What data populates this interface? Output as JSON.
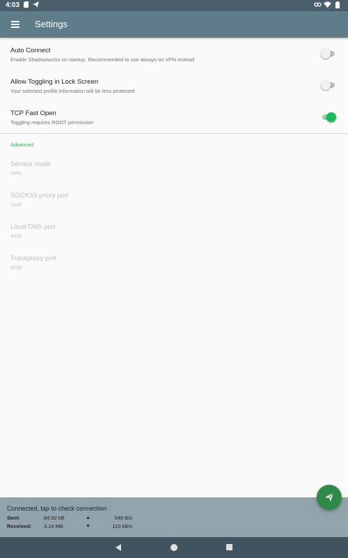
{
  "status_bar": {
    "time": "4:03",
    "icons": [
      "sd-card-icon",
      "send-icon",
      "vpn-key-icon",
      "wifi-icon",
      "battery-icon"
    ]
  },
  "app_bar": {
    "title": "Settings",
    "menu_icon": "menu-icon"
  },
  "preferences": {
    "auto_connect": {
      "title": "Auto Connect",
      "summary": "Enable Shadowsocks on startup. Recommended to use always-on VPN instead",
      "enabled": false
    },
    "lock_screen": {
      "title": "Allow Toggling in Lock Screen",
      "summary": "Your selected profile information will be less protected",
      "enabled": false
    },
    "tcp_fast_open": {
      "title": "TCP Fast Open",
      "summary": "Toggling requires ROOT permission",
      "enabled": true
    }
  },
  "advanced": {
    "header": "Advanced",
    "items": [
      {
        "title": "Service mode",
        "value": "VPN"
      },
      {
        "title": "SOCKS5 proxy port",
        "value": "1080"
      },
      {
        "title": "Local DNS port",
        "value": "5450"
      },
      {
        "title": "Transproxy port",
        "value": "8200"
      }
    ]
  },
  "stats": {
    "status": "Connected, tap to check connection",
    "sent_label": "Sent:",
    "sent_total": "84.92 kB",
    "sent_arrow": "▲",
    "sent_rate": "548 B/s",
    "received_label": "Received:",
    "received_total": "3.14 MB",
    "received_arrow": "▼",
    "received_rate": "110 kB/s"
  },
  "fab_icon": "send-icon",
  "colors": {
    "toolbar": "#5f7c8a",
    "status_bar": "#4a5f6b",
    "accent": "#1fb75b",
    "fab": "#2e8a46",
    "stats_bar": "#91a4ad",
    "nav_bar": "#3f545f"
  }
}
